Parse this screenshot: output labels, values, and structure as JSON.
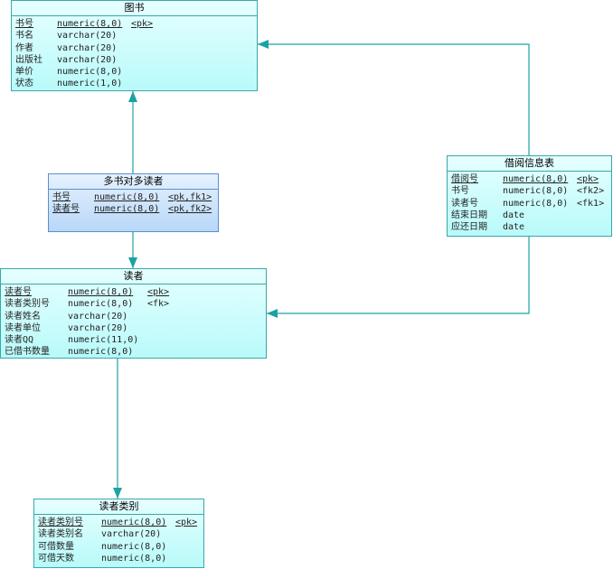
{
  "entities": {
    "book": {
      "title": "图书",
      "columns": [
        {
          "name": "书号",
          "type": "numeric(8,0)",
          "constraint": "<pk>",
          "key": true
        },
        {
          "name": "书名",
          "type": "varchar(20)",
          "constraint": "",
          "key": false
        },
        {
          "name": "作者",
          "type": "varchar(20)",
          "constraint": "",
          "key": false
        },
        {
          "name": "出版社",
          "type": "varchar(20)",
          "constraint": "",
          "key": false
        },
        {
          "name": "单价",
          "type": "numeric(8,0)",
          "constraint": "",
          "key": false
        },
        {
          "name": "状态",
          "type": "numeric(1,0)",
          "constraint": "",
          "key": false
        }
      ]
    },
    "many_to_many": {
      "title": "多书对多读者",
      "columns": [
        {
          "name": "书号",
          "type": "numeric(8,0)",
          "constraint": "<pk,fk1>",
          "key": true
        },
        {
          "name": "读者号",
          "type": "numeric(8,0)",
          "constraint": "<pk,fk2>",
          "key": true
        }
      ]
    },
    "borrow_info": {
      "title": "借阅信息表",
      "columns": [
        {
          "name": "借阅号",
          "type": "numeric(8,0)",
          "constraint": "<pk>",
          "key": true
        },
        {
          "name": "书号",
          "type": "numeric(8,0)",
          "constraint": "<fk2>",
          "key": false
        },
        {
          "name": "读者号",
          "type": "numeric(8,0)",
          "constraint": "<fk1>",
          "key": false
        },
        {
          "name": "结束日期",
          "type": "date",
          "constraint": "",
          "key": false
        },
        {
          "name": "应还日期",
          "type": "date",
          "constraint": "",
          "key": false
        }
      ]
    },
    "reader": {
      "title": "读者",
      "columns": [
        {
          "name": "读者号",
          "type": "numeric(8,0)",
          "constraint": "<pk>",
          "key": true
        },
        {
          "name": "读者类别号",
          "type": "numeric(8,0)",
          "constraint": "<fk>",
          "key": false
        },
        {
          "name": "读者姓名",
          "type": "varchar(20)",
          "constraint": "",
          "key": false
        },
        {
          "name": "读者单位",
          "type": "varchar(20)",
          "constraint": "",
          "key": false
        },
        {
          "name": "读者QQ",
          "type": "numeric(11,0)",
          "constraint": "",
          "key": false
        },
        {
          "name": "已借书数量",
          "type": "numeric(8,0)",
          "constraint": "",
          "key": false
        }
      ]
    },
    "reader_category": {
      "title": "读者类别",
      "columns": [
        {
          "name": "读者类别号",
          "type": "numeric(8,0)",
          "constraint": "<pk>",
          "key": true
        },
        {
          "name": "读者类别名",
          "type": "varchar(20)",
          "constraint": "",
          "key": false
        },
        {
          "name": "可借数量",
          "type": "numeric(8,0)",
          "constraint": "",
          "key": false
        },
        {
          "name": "可借天数",
          "type": "numeric(8,0)",
          "constraint": "",
          "key": false
        }
      ]
    }
  },
  "colors": {
    "connector": "#1aa3a3",
    "entity_border": "#3aa7a7",
    "assoc_border": "#5b8fd0"
  }
}
